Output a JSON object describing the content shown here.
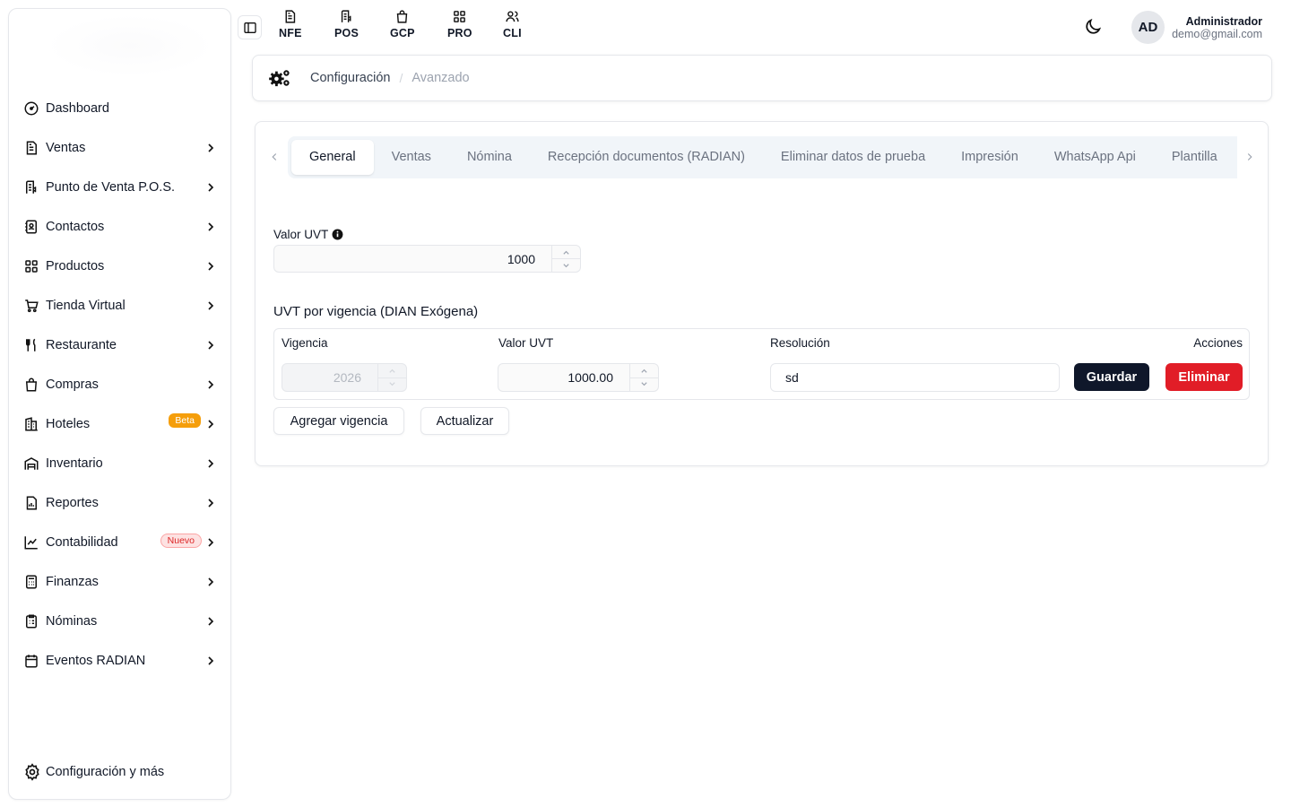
{
  "sidebar": {
    "items": [
      {
        "label": "Dashboard"
      },
      {
        "label": "Ventas"
      },
      {
        "label": "Punto de Venta P.O.S."
      },
      {
        "label": "Contactos"
      },
      {
        "label": "Productos"
      },
      {
        "label": "Tienda Virtual"
      },
      {
        "label": "Restaurante"
      },
      {
        "label": "Compras"
      },
      {
        "label": "Hoteles",
        "badge": "Beta"
      },
      {
        "label": "Inventario"
      },
      {
        "label": "Reportes"
      },
      {
        "label": "Contabilidad",
        "badge": "Nuevo"
      },
      {
        "label": "Finanzas"
      },
      {
        "label": "Nóminas"
      },
      {
        "label": "Eventos RADIAN"
      }
    ],
    "footer": "Configuración y más"
  },
  "topbar": {
    "quick_links": [
      "NFE",
      "POS",
      "GCP",
      "PRO",
      "CLI"
    ],
    "avatar_initials": "AD",
    "user_name": "Administrador",
    "user_email": "demo@gmail.com"
  },
  "breadcrumb": {
    "parent": "Configuración",
    "separator": "/",
    "current": "Avanzado"
  },
  "tabs": [
    "General",
    "Ventas",
    "Nómina",
    "Recepción documentos (RADIAN)",
    "Eliminar datos de prueba",
    "Impresión",
    "WhatsApp Api",
    "Plantilla"
  ],
  "active_tab": "General",
  "uvt": {
    "label": "Valor UVT",
    "value": "1000"
  },
  "vigencias": {
    "title": "UVT por vigencia (DIAN Exógena)",
    "headers": {
      "vigencia": "Vigencia",
      "valor": "Valor UVT",
      "resolucion": "Resolución",
      "acciones": "Acciones"
    },
    "row": {
      "vigencia": "2026",
      "valor": "1000.00",
      "resolucion": "sd"
    },
    "save_label": "Guardar",
    "delete_label": "Eliminar",
    "add_label": "Agregar vigencia",
    "update_label": "Actualizar"
  },
  "colors": {
    "primary": "#0f172a",
    "danger": "#e11d27",
    "beta": "#f59e0b",
    "nuevo": "#dc2626"
  }
}
